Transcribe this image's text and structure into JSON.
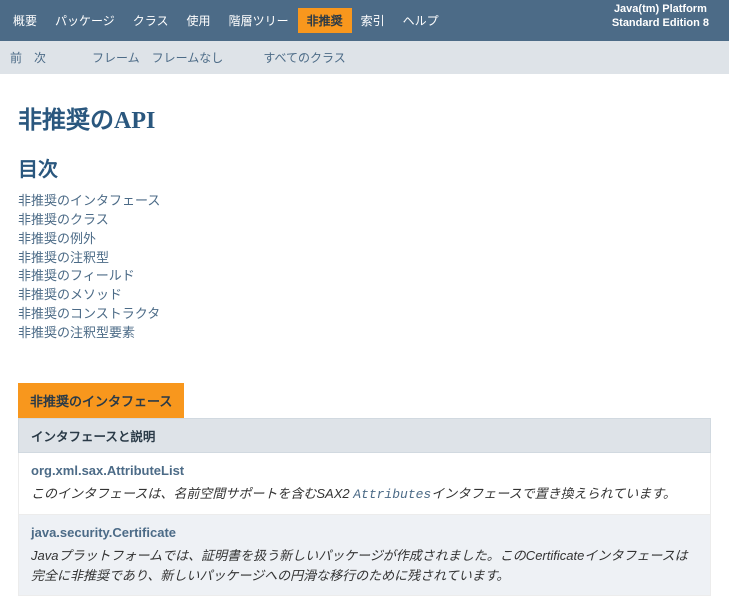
{
  "platform": {
    "line1": "Java(tm) Platform",
    "line2": "Standard Edition 8"
  },
  "nav": {
    "items": [
      {
        "label": "概要",
        "active": false
      },
      {
        "label": "パッケージ",
        "active": false
      },
      {
        "label": "クラス",
        "active": false
      },
      {
        "label": "使用",
        "active": false
      },
      {
        "label": "階層ツリー",
        "active": false
      },
      {
        "label": "非推奨",
        "active": true
      },
      {
        "label": "索引",
        "active": false
      },
      {
        "label": "ヘルプ",
        "active": false
      }
    ]
  },
  "subnav": {
    "prev": "前",
    "next": "次",
    "frames": "フレーム",
    "noframes": "フレームなし",
    "allclasses": "すべてのクラス"
  },
  "page": {
    "title": "非推奨のAPI",
    "toc_title": "目次"
  },
  "toc": [
    "非推奨のインタフェース",
    "非推奨のクラス",
    "非推奨の例外",
    "非推奨の注釈型",
    "非推奨のフィールド",
    "非推奨のメソッド",
    "非推奨のコンストラクタ",
    "非推奨の注釈型要素"
  ],
  "table": {
    "header": "非推奨のインタフェース",
    "subheader": "インタフェースと説明",
    "rows": [
      {
        "class": "org.xml.sax.AttributeList",
        "desc_pre": "このインタフェースは、名前空間サポートを含むSAX2 ",
        "desc_link": "Attributes",
        "desc_post": "インタフェースで置き換えられています。"
      },
      {
        "class": "java.security.Certificate",
        "desc_pre": "Javaプラットフォームでは、証明書を扱う新しいパッケージが作成されました。このCertificateインタフェースは完全に非推奨であり、新しいパッケージへの円滑な移行のために残されています。",
        "desc_link": "",
        "desc_post": ""
      }
    ]
  }
}
